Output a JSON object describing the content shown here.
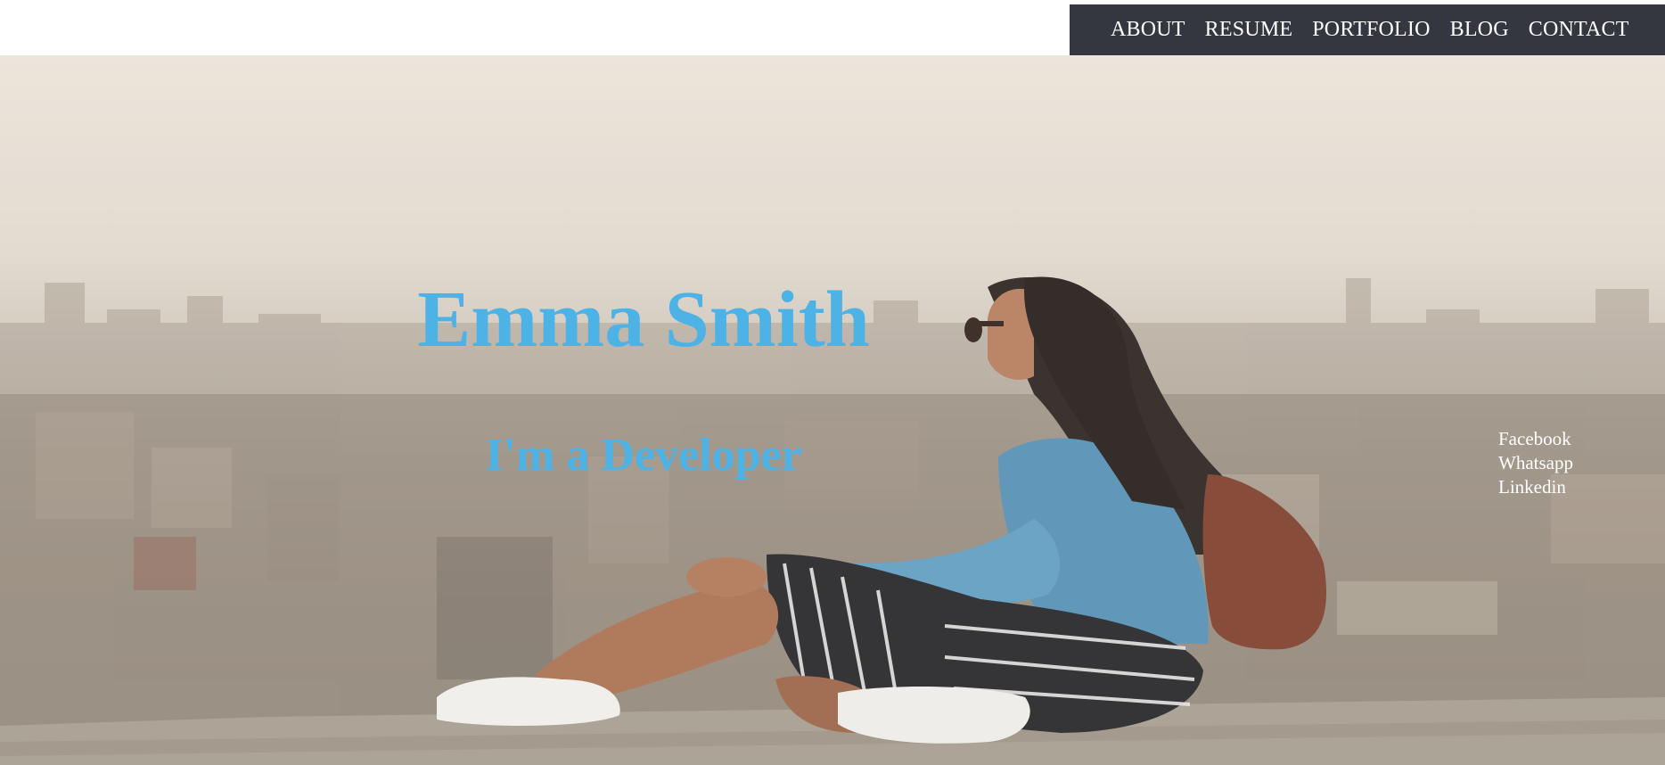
{
  "nav": {
    "items": [
      {
        "label": "ABOUT"
      },
      {
        "label": "RESUME"
      },
      {
        "label": "PORTFOLIO"
      },
      {
        "label": "BLOG"
      },
      {
        "label": "CONTACT"
      }
    ]
  },
  "hero": {
    "name": "Emma Smith",
    "tagline": "I'm a Developer"
  },
  "social": {
    "links": [
      {
        "label": "Facebook"
      },
      {
        "label": "Whatsapp"
      },
      {
        "label": "Linkedin"
      }
    ]
  },
  "colors": {
    "nav_background": "#343640",
    "nav_text": "#ffffff",
    "hero_heading": "#4db3e6",
    "social_text": "#ffffff"
  }
}
